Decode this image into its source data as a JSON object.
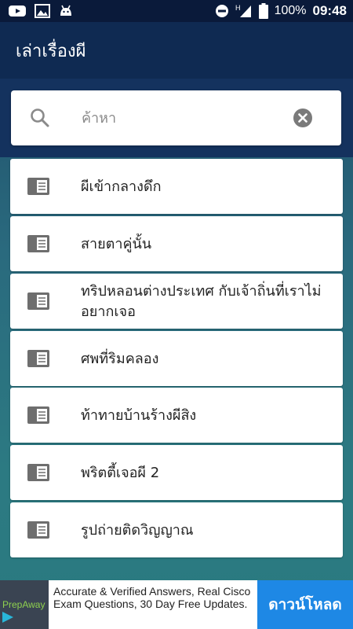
{
  "status_bar": {
    "battery": "100%",
    "time": "09:48",
    "signal_label": "H"
  },
  "app_bar": {
    "title": "เล่าเรื่องผี"
  },
  "search": {
    "placeholder": "ค้าหา",
    "value": ""
  },
  "stories": [
    {
      "title": "ผีเข้ากลางดึก"
    },
    {
      "title": "สายตาคู่นั้น"
    },
    {
      "title": "ทริปหลอนต่างประเทศ กับเจ้าถิ่นที่เราไม่อยากเจอ"
    },
    {
      "title": "ศพที่ริมคลอง"
    },
    {
      "title": "ท้าทายบ้านร้างผีสิง"
    },
    {
      "title": "พริตตี้เจอผี 2"
    },
    {
      "title": "รูปถ่ายติดวิญญาณ"
    }
  ],
  "ad": {
    "brand": "PrepAway",
    "text": "Accurate & Verified Answers, Real Cisco Exam Questions, 30 Day Free Updates.",
    "button_label": "ดาวน์โหลด"
  },
  "colors": {
    "status_bar": "#0a1a3a",
    "app_bar": "#0f2a52",
    "accent": "#1e88e5"
  }
}
